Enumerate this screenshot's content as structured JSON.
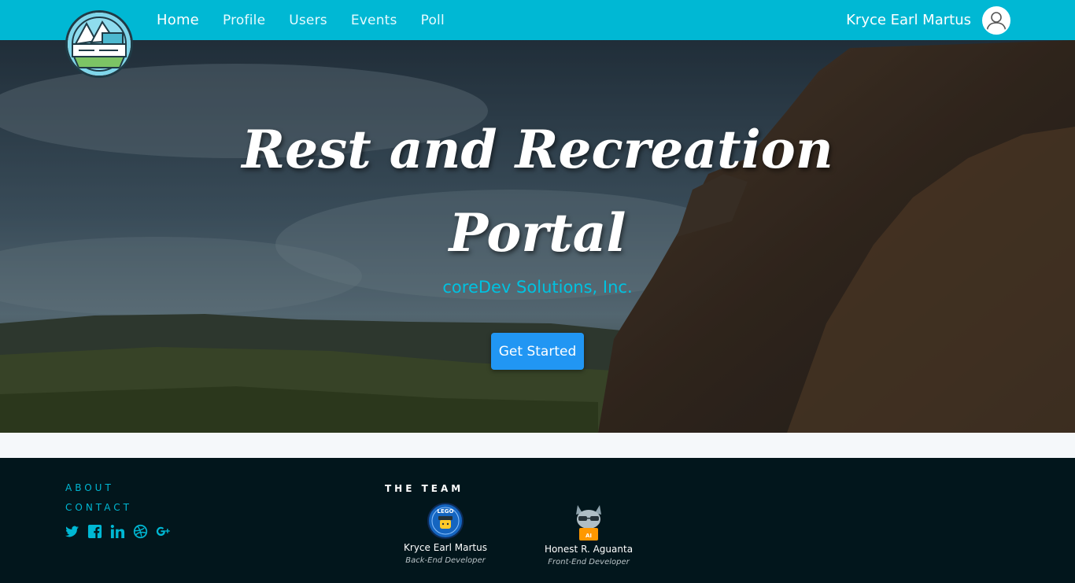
{
  "nav": {
    "links": [
      {
        "label": "Home",
        "active": true
      },
      {
        "label": "Profile",
        "active": false
      },
      {
        "label": "Users",
        "active": false
      },
      {
        "label": "Events",
        "active": false
      },
      {
        "label": "Poll",
        "active": false
      }
    ],
    "user_name": "Kryce Earl Martus",
    "logo_icon": "mountain-landscape-logo",
    "avatar_icon": "user-avatar-icon"
  },
  "hero": {
    "title_line1": "Rest and Recreation",
    "title_line2": "Portal",
    "subtitle": "coreDev Solutions, Inc.",
    "cta_label": "Get Started"
  },
  "footer": {
    "about": "ABOUT",
    "contact": "CONTACT",
    "socials": [
      "twitter-icon",
      "facebook-icon",
      "linkedin-icon",
      "dribbble-icon",
      "google-plus-icon"
    ],
    "team_heading": "THE TEAM",
    "team": [
      {
        "name": "Kryce Earl Martus",
        "role": "Back-End Developer"
      },
      {
        "name": "Honest R. Aguanta",
        "role": "Front-End Developer"
      }
    ]
  },
  "colors": {
    "nav_bg": "#00b8d4",
    "accent": "#00c2e0",
    "button": "#2196f3",
    "footer_bg": "#02161c"
  }
}
